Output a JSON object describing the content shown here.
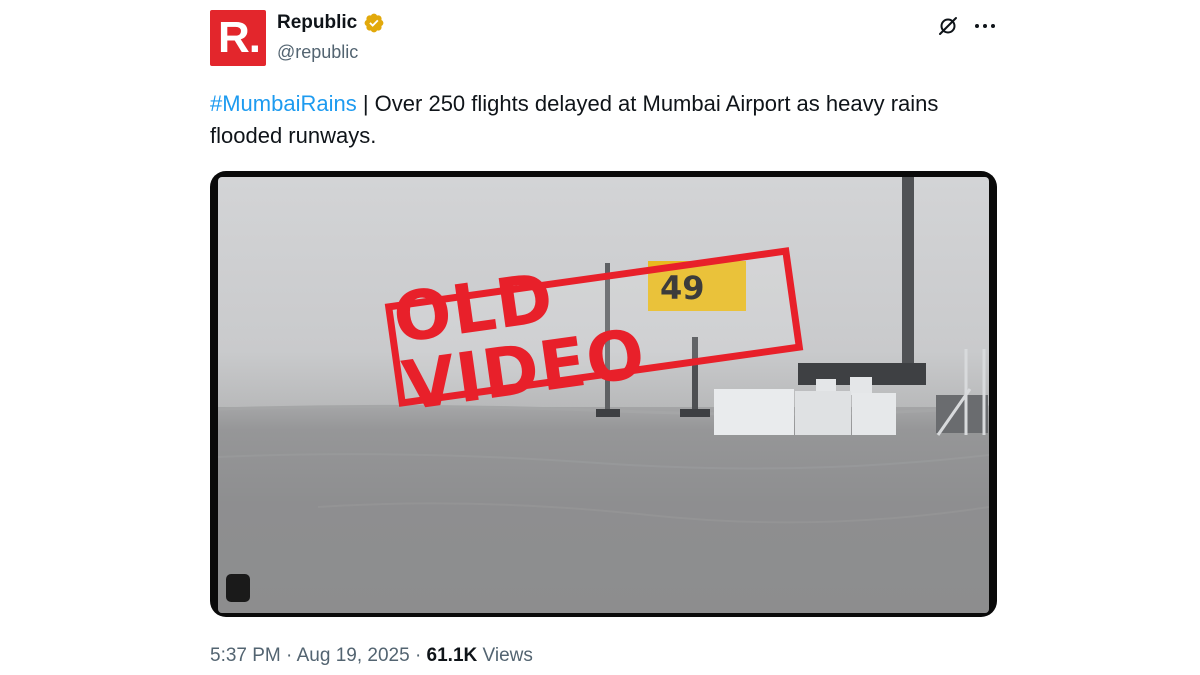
{
  "author": {
    "display_name": "Republic",
    "handle": "@republic",
    "avatar_text": "R.",
    "verified": true,
    "verified_color": "#f4b400",
    "avatar_color": "#e3262c"
  },
  "header_icons": [
    "grok-icon",
    "more-icon"
  ],
  "tweet": {
    "hashtag": "#MumbaiRains",
    "text": " | Over 250 flights delayed at Mumbai Airport as heavy rains flooded runways.",
    "hashtag_color": "#1d9bf0"
  },
  "media": {
    "overlay_stamp": "OLD VIDEO",
    "stamp_color": "#e8202a",
    "sign_text": "49"
  },
  "footer": {
    "time": "5:37 PM",
    "separator": "·",
    "date": "Aug 19, 2025",
    "views_count": "61.1K",
    "views_label": "Views"
  }
}
